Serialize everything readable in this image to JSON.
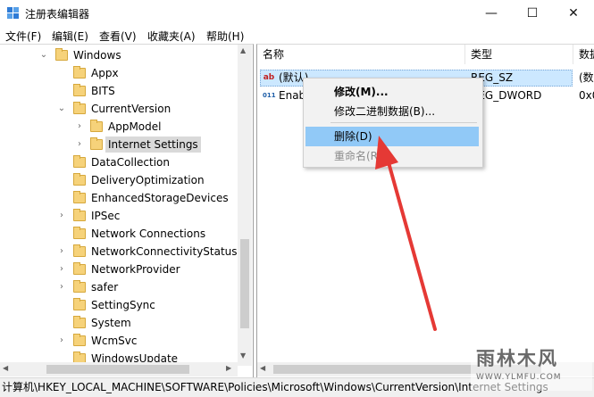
{
  "window": {
    "title": "注册表编辑器",
    "controls": {
      "minimize": "—",
      "maximize": "☐",
      "close": "✕"
    }
  },
  "menu": [
    "文件(F)",
    "编辑(E)",
    "查看(V)",
    "收藏夹(A)",
    "帮助(H)"
  ],
  "tree": {
    "items": [
      {
        "label": "Windows",
        "expander": "⌄"
      },
      {
        "label": "Appx",
        "expander": ""
      },
      {
        "label": "BITS",
        "expander": ""
      },
      {
        "label": "CurrentVersion",
        "expander": "⌄"
      },
      {
        "label": "AppModel",
        "expander": "›"
      },
      {
        "label": "Internet Settings",
        "expander": "›",
        "selected": true
      },
      {
        "label": "DataCollection",
        "expander": ""
      },
      {
        "label": "DeliveryOptimization",
        "expander": ""
      },
      {
        "label": "EnhancedStorageDevices",
        "expander": ""
      },
      {
        "label": "IPSec",
        "expander": "›"
      },
      {
        "label": "Network Connections",
        "expander": ""
      },
      {
        "label": "NetworkConnectivityStatusIr",
        "expander": "›"
      },
      {
        "label": "NetworkProvider",
        "expander": "›"
      },
      {
        "label": "safer",
        "expander": "›"
      },
      {
        "label": "SettingSync",
        "expander": ""
      },
      {
        "label": "System",
        "expander": ""
      },
      {
        "label": "WcmSvc",
        "expander": "›"
      },
      {
        "label": "WindowsUpdate",
        "expander": ""
      }
    ]
  },
  "list": {
    "headers": {
      "name": "名称",
      "type": "类型",
      "data": "数据"
    },
    "rows": [
      {
        "icon": "ab",
        "name": "(默认)",
        "type": "REG_SZ",
        "data": "(数"
      },
      {
        "icon": "011",
        "name": "Enab",
        "type": "REG_DWORD",
        "data": "0x0"
      }
    ]
  },
  "context_menu": {
    "modify": "修改(M)...",
    "modify_binary": "修改二进制数据(B)...",
    "delete": "删除(D)",
    "rename": "重命名(R)"
  },
  "status_bar": "计算机\\HKEY_LOCAL_MACHINE\\SOFTWARE\\Policies\\Microsoft\\Windows\\CurrentVersion\\Internet Settings",
  "watermark": {
    "brand": "雨林木风",
    "url": "WWW.YLMFU.COM"
  },
  "colors": {
    "selection": "#cce8ff",
    "menu_highlight": "#91c9f7",
    "arrow": "#e53935"
  }
}
